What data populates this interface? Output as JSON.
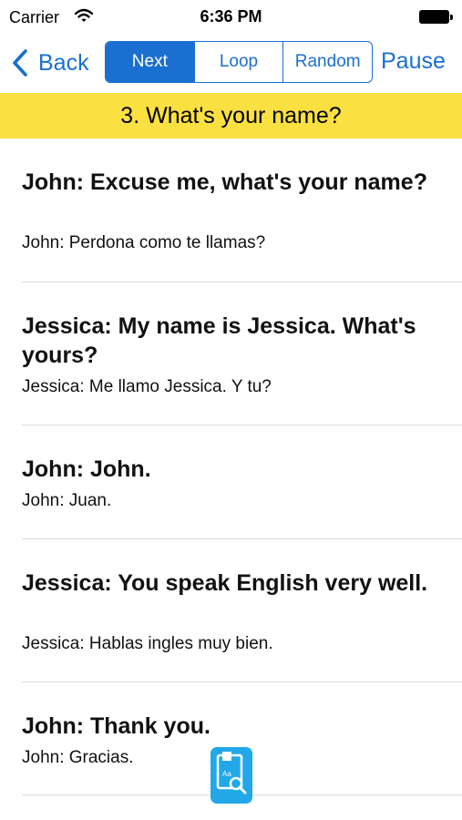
{
  "status_bar": {
    "carrier": "Carrier",
    "time": "6:36 PM",
    "icons": [
      "wifi-icon",
      "battery-icon"
    ]
  },
  "nav": {
    "back_label": "Back",
    "segments": [
      {
        "label": "Next",
        "selected": true
      },
      {
        "label": "Loop",
        "selected": false
      },
      {
        "label": "Random",
        "selected": false
      }
    ],
    "pause_label": "Pause",
    "accent_color": "#1a6fd1"
  },
  "banner": {
    "title": "3. What's your name?",
    "color": "#fbe041"
  },
  "dialogue": [
    {
      "english": "John: Excuse me, what's your name?",
      "spanish": "John: Perdona como te llamas?"
    },
    {
      "english": "Jessica: My name is Jessica. What's yours?",
      "spanish": "Jessica: Me llamo Jessica. Y tu?"
    },
    {
      "english": "John: John.",
      "spanish": "John: Juan."
    },
    {
      "english": "Jessica: You speak English very well.",
      "spanish": "Jessica: Hablas ingles muy bien."
    },
    {
      "english": "John: Thank you.",
      "spanish": "John: Gracias."
    }
  ],
  "dictionary_button": {
    "icon": "dictionary-search-icon",
    "icon_text": "Aa",
    "color": "#22a8e8"
  }
}
